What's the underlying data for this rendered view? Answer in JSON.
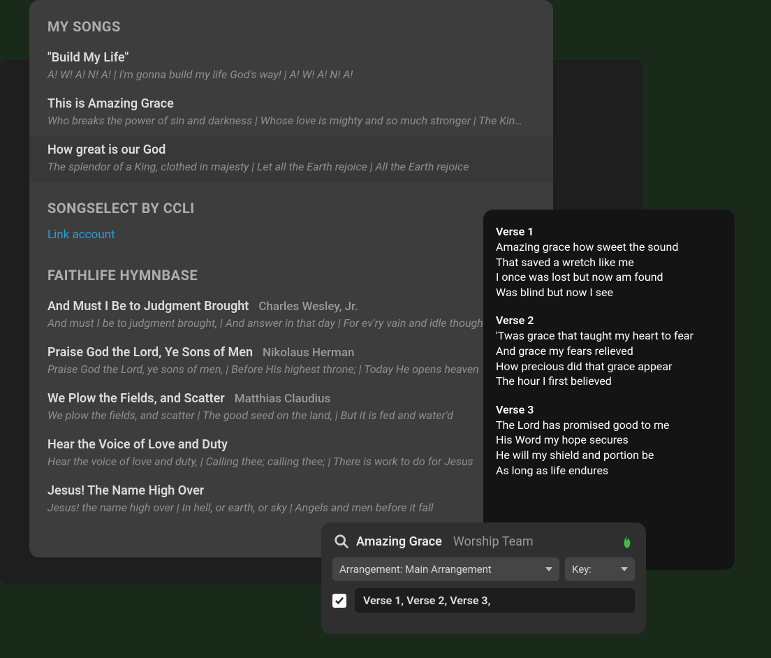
{
  "songList": {
    "mySongs": {
      "header": "MY SONGS",
      "items": [
        {
          "title": "\"Build My Life\"",
          "snippet": "A! W! A! N! A! | I'm gonna build my life God's way! | A! W! A! N! A!"
        },
        {
          "title": "This is Amazing Grace",
          "snippet": "Who breaks the power of sin and darkness | Whose love is mighty and so much stronger | The Kin…"
        },
        {
          "title": "How great is our God",
          "snippet": "The splendor of a King, clothed in majesty | Let all the Earth rejoice | All the Earth rejoice"
        }
      ]
    },
    "songselect": {
      "header": "SONGSELECT BY CCLI",
      "linkLabel": "Link account"
    },
    "hymnbase": {
      "header": "FAITHLIFE HYMNBASE",
      "items": [
        {
          "title": "And Must I Be to Judgment Brought",
          "author": "Charles Wesley, Jr.",
          "snippet": "And must I be to judgment brought, | And answer in that day | For ev'ry vain and idle thought"
        },
        {
          "title": "Praise God the Lord, Ye Sons of Men",
          "author": "Nikolaus Herman",
          "snippet": "Praise God the Lord, ye sons of men, | Before His highest throne; | Today He opens heaven"
        },
        {
          "title": "We Plow the Fields, and Scatter",
          "author": "Matthias Claudius",
          "snippet": "We plow the fields, and scatter | The good seed on the land, | But it is fed and water'd"
        },
        {
          "title": "Hear the Voice of Love and Duty",
          "author": "",
          "snippet": "Hear the voice of love and duty, | Calling thee; calling thee; | There is work to do for Jesus"
        },
        {
          "title": "Jesus! The Name High Over",
          "author": "",
          "snippet": "Jesus! the name high over | In hell, or earth, or sky | Angels and men before it fall"
        }
      ]
    }
  },
  "lyrics": {
    "verses": [
      {
        "heading": "Verse 1",
        "lines": [
          "Amazing grace how sweet the sound",
          "That saved a wretch like me",
          "I once was lost but now am found",
          "Was blind but now I see"
        ]
      },
      {
        "heading": "Verse 2",
        "lines": [
          "'Twas grace that taught my heart to fear",
          "And grace my fears relieved",
          "How precious did that grace appear",
          "The hour I first believed"
        ]
      },
      {
        "heading": "Verse 3",
        "lines": [
          "The Lord has promised good to me",
          "His Word my hope secures",
          "He will my shield and portion be",
          "As long as life endures"
        ]
      }
    ]
  },
  "search": {
    "title": "Amazing Grace",
    "subtitle": "Worship Team",
    "arrangement": "Arrangement: Main Arrangement",
    "key": "Key:",
    "verses": "Verse 1, Verse 2, Verse 3,"
  }
}
